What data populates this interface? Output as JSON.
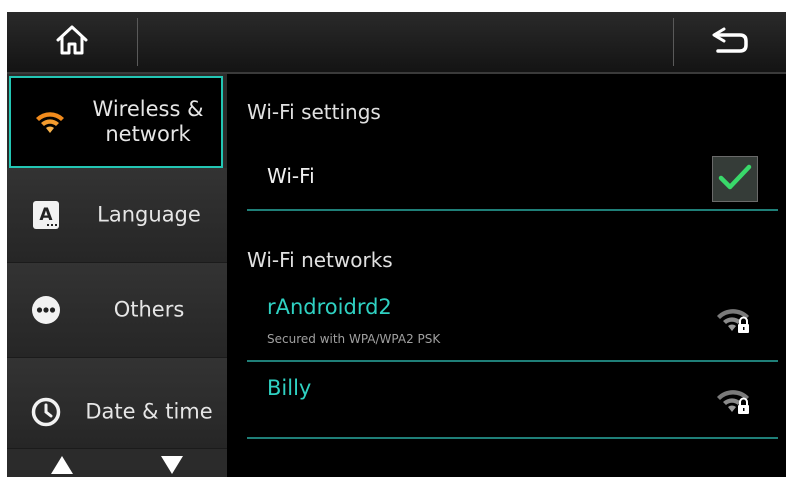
{
  "topbar": {
    "home_icon": "home-icon",
    "back_icon": "back-arrow-icon"
  },
  "sidebar": {
    "items": [
      {
        "label": "Wireless & network",
        "icon": "wifi-icon",
        "active": true
      },
      {
        "label": "Language",
        "icon": "language-icon"
      },
      {
        "label": "Others",
        "icon": "more-icon"
      },
      {
        "label": "Date & time",
        "icon": "clock-icon"
      }
    ],
    "scroll_up_icon": "triangle-up-icon",
    "scroll_down_icon": "triangle-down-icon"
  },
  "main": {
    "wifi_settings_title": "Wi-Fi settings",
    "wifi_label": "Wi-Fi",
    "wifi_checked": true,
    "wifi_networks_title": "Wi-Fi networks",
    "networks": [
      {
        "name": "rAndroidrd2",
        "subtitle": "Secured with WPA/WPA2 PSK",
        "icon": "wifi-lock-icon"
      },
      {
        "name": "Billy",
        "subtitle": "",
        "icon": "wifi-lock-icon"
      }
    ]
  },
  "colors": {
    "accent": "#2fd1c2",
    "check": "#39d86a",
    "wifi_orange": "#f08a1c"
  }
}
